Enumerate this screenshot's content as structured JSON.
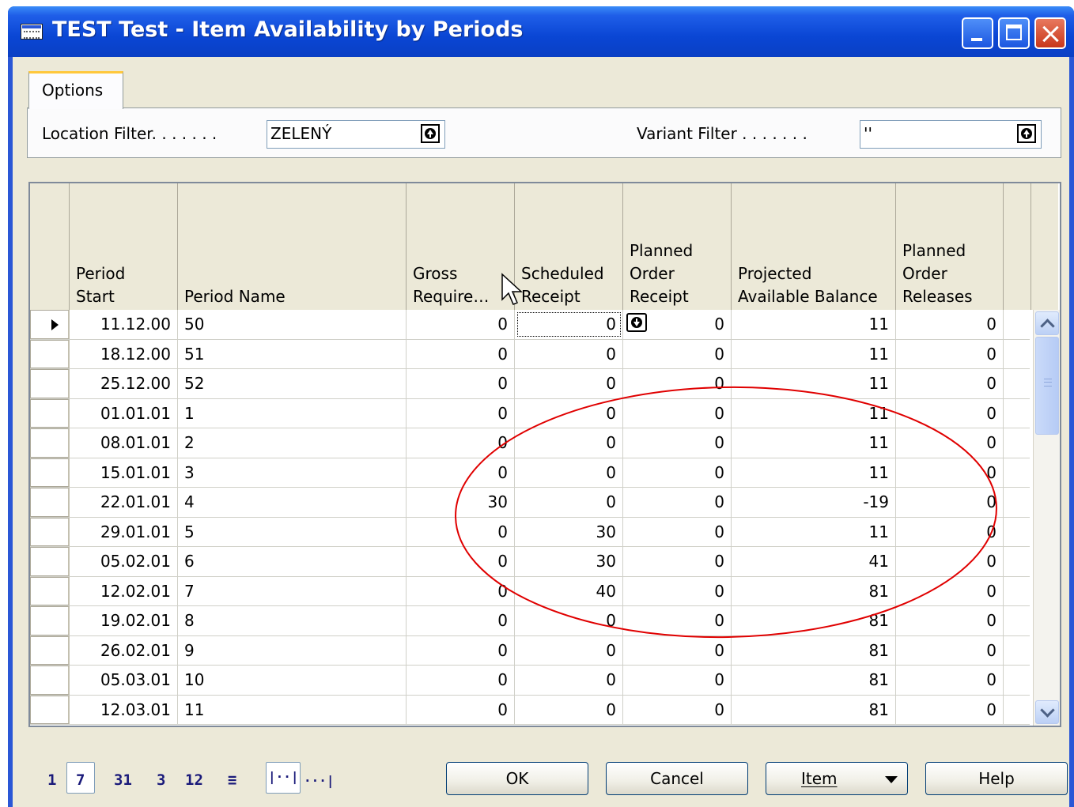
{
  "window": {
    "title": "TEST Test - Item Availability by Periods"
  },
  "options": {
    "tab_label": "Options",
    "location_filter_label": "Location Filter. . . . . . .",
    "location_filter_value": "ZELENÝ",
    "variant_filter_label": "Variant Filter . . . . . . .",
    "variant_filter_value": "''"
  },
  "table": {
    "headers": {
      "period_start": "Period\nStart",
      "period_name": "Period Name",
      "gross": "Gross\nRequire…",
      "scheduled": "Scheduled\nReceipt",
      "planned_receipt": "Planned\nOrder\nReceipt",
      "projected": "Projected\nAvailable Balance",
      "planned_releases": "Planned\nOrder\nReleases"
    },
    "rows": [
      {
        "start": "11.12.00",
        "name": "50",
        "gross": "0",
        "sched": "0",
        "planned": "0",
        "proj": "11",
        "release": "0"
      },
      {
        "start": "18.12.00",
        "name": "51",
        "gross": "0",
        "sched": "0",
        "planned": "0",
        "proj": "11",
        "release": "0"
      },
      {
        "start": "25.12.00",
        "name": "52",
        "gross": "0",
        "sched": "0",
        "planned": "0",
        "proj": "11",
        "release": "0"
      },
      {
        "start": "01.01.01",
        "name": "1",
        "gross": "0",
        "sched": "0",
        "planned": "0",
        "proj": "11",
        "release": "0"
      },
      {
        "start": "08.01.01",
        "name": "2",
        "gross": "0",
        "sched": "0",
        "planned": "0",
        "proj": "11",
        "release": "0"
      },
      {
        "start": "15.01.01",
        "name": "3",
        "gross": "0",
        "sched": "0",
        "planned": "0",
        "proj": "11",
        "release": "0"
      },
      {
        "start": "22.01.01",
        "name": "4",
        "gross": "30",
        "sched": "0",
        "planned": "0",
        "proj": "-19",
        "release": "0"
      },
      {
        "start": "29.01.01",
        "name": "5",
        "gross": "0",
        "sched": "30",
        "planned": "0",
        "proj": "11",
        "release": "0"
      },
      {
        "start": "05.02.01",
        "name": "6",
        "gross": "0",
        "sched": "30",
        "planned": "0",
        "proj": "41",
        "release": "0"
      },
      {
        "start": "12.02.01",
        "name": "7",
        "gross": "0",
        "sched": "40",
        "planned": "0",
        "proj": "81",
        "release": "0"
      },
      {
        "start": "19.02.01",
        "name": "8",
        "gross": "0",
        "sched": "0",
        "planned": "0",
        "proj": "81",
        "release": "0"
      },
      {
        "start": "26.02.01",
        "name": "9",
        "gross": "0",
        "sched": "0",
        "planned": "0",
        "proj": "81",
        "release": "0"
      },
      {
        "start": "05.03.01",
        "name": "10",
        "gross": "0",
        "sched": "0",
        "planned": "0",
        "proj": "81",
        "release": "0"
      },
      {
        "start": "12.03.01",
        "name": "11",
        "gross": "0",
        "sched": "0",
        "planned": "0",
        "proj": "81",
        "release": "0"
      }
    ]
  },
  "footer": {
    "period_scale": [
      "1",
      "7",
      "31",
      "3",
      "12",
      "≡"
    ],
    "selected_scale": "7",
    "amount_type": [
      "|··|",
      "···|"
    ],
    "ok_label": "OK",
    "cancel_label": "Cancel",
    "item_label": "Item",
    "help_label": "Help"
  },
  "colors": {
    "annotation": "#e00000",
    "title_bar": "#0a46d4"
  }
}
